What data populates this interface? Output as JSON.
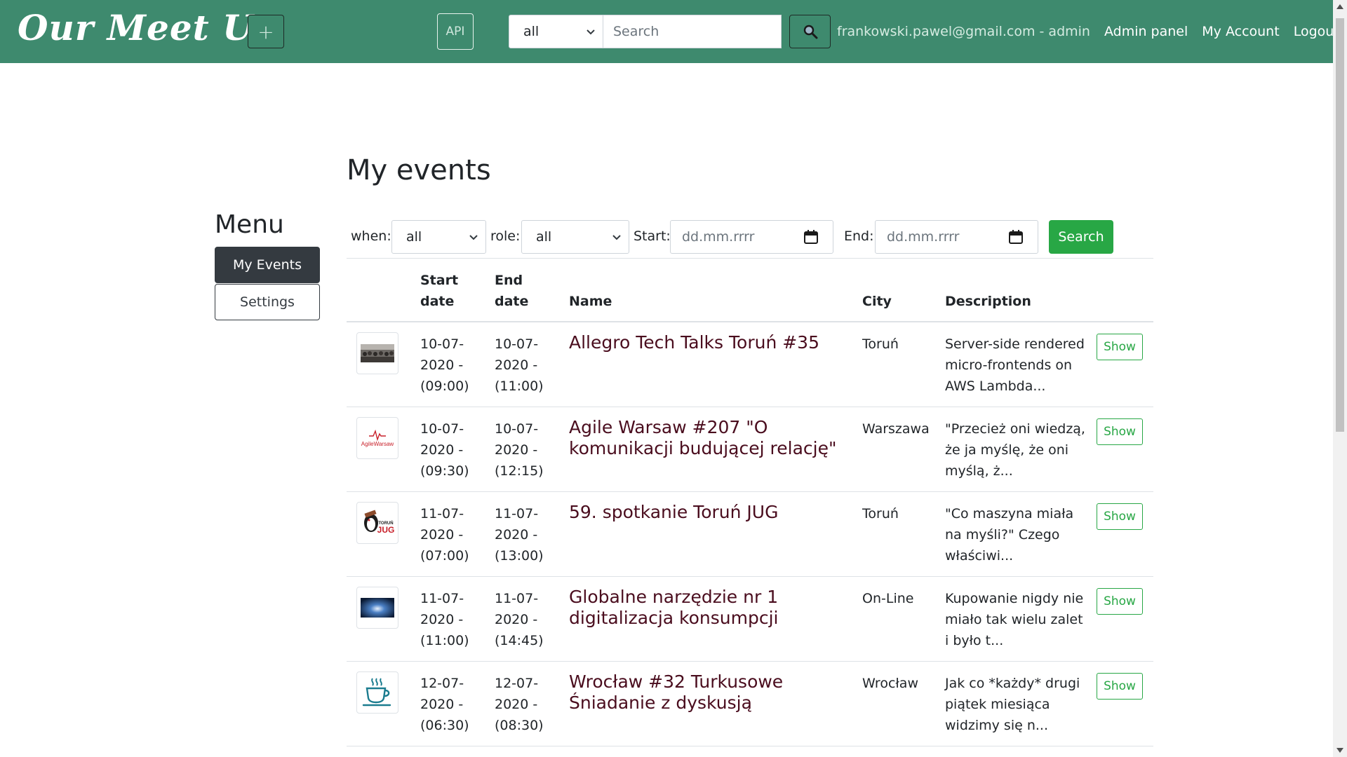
{
  "navbar": {
    "brand": "Our Meet Up",
    "add_label": "+",
    "api_label": "API",
    "search_scope": "all",
    "search_placeholder": "Search",
    "user": "frankowski.pawel@gmail.com - admin",
    "links": [
      "Admin panel",
      "My Account",
      "Logout"
    ]
  },
  "sidebar": {
    "title": "Menu",
    "items": [
      "My Events",
      "Settings"
    ],
    "active_index": 0
  },
  "main": {
    "title": "My events",
    "filters": {
      "when_label": "when:",
      "when_value": "all",
      "role_label": "role:",
      "role_value": "all",
      "start_label": "Start:",
      "start_placeholder": "dd.mm.rrrr",
      "end_label": "End:",
      "end_placeholder": "dd.mm.rrrr",
      "search_label": "Search"
    },
    "columns": {
      "start_line1": "Start",
      "start_line2": "date",
      "end_line1": "End",
      "end_line2": "date",
      "name": "Name",
      "city": "City",
      "description": "Description"
    },
    "events": [
      {
        "start_day": "10-07-",
        "start_year": "2020 -",
        "start_time": "(09:00)",
        "end_day": "10-07-",
        "end_year": "2020 -",
        "end_time": "(11:00)",
        "name": "Allegro Tech Talks Toruń #35",
        "city": "Toruń",
        "description": "Server-side rendered micro-frontends on AWS Lambda...",
        "action": "Show",
        "thumb": "photo-audience"
      },
      {
        "start_day": "10-07-",
        "start_year": "2020 -",
        "start_time": "(09:30)",
        "end_day": "10-07-",
        "end_year": "2020 -",
        "end_time": "(12:15)",
        "name": "Agile Warsaw #207 \"O komunikacji budującej relację\"",
        "city": "Warszawa",
        "description": "\"Przecież oni wiedzą, że ja myślę, że oni myślą, ż...",
        "action": "Show",
        "thumb": "agile-warsaw-logo",
        "thumb_text": "AgileWarsaw"
      },
      {
        "start_day": "11-07-",
        "start_year": "2020 -",
        "start_time": "(07:00)",
        "end_day": "11-07-",
        "end_year": "2020 -",
        "end_time": "(13:00)",
        "name": "59. spotkanie Toruń JUG",
        "city": "Toruń",
        "description": "\"Co maszyna miała na myśli?\" Czego właściwi...",
        "action": "Show",
        "thumb": "torun-jug-logo",
        "thumb_text_top": "TORUŃ",
        "thumb_text_bottom": "JUG"
      },
      {
        "start_day": "11-07-",
        "start_year": "2020 -",
        "start_time": "(11:00)",
        "end_day": "11-07-",
        "end_year": "2020 -",
        "end_time": "(14:45)",
        "name": "Globalne narzędzie nr 1 digitalizacja konsumpcji",
        "city": "On-Line",
        "description": "Kupowanie nigdy nie miało tak wielu zalet i było t...",
        "action": "Show",
        "thumb": "photo-space"
      },
      {
        "start_day": "12-07-",
        "start_year": "2020 -",
        "start_time": "(06:30)",
        "end_day": "12-07-",
        "end_year": "2020 -",
        "end_time": "(08:30)",
        "name": "Wrocław #32 Turkusowe Śniadanie z dyskusją",
        "city": "Wrocław",
        "description": "Jak co *każdy* drugi piątek miesiąca widzimy się n...",
        "action": "Show",
        "thumb": "coffee-cup-icon"
      }
    ]
  },
  "colors": {
    "navbar": "#3e8a6e",
    "event_name": "#4a0d1e",
    "success": "#28a745",
    "dark": "#343a40"
  }
}
